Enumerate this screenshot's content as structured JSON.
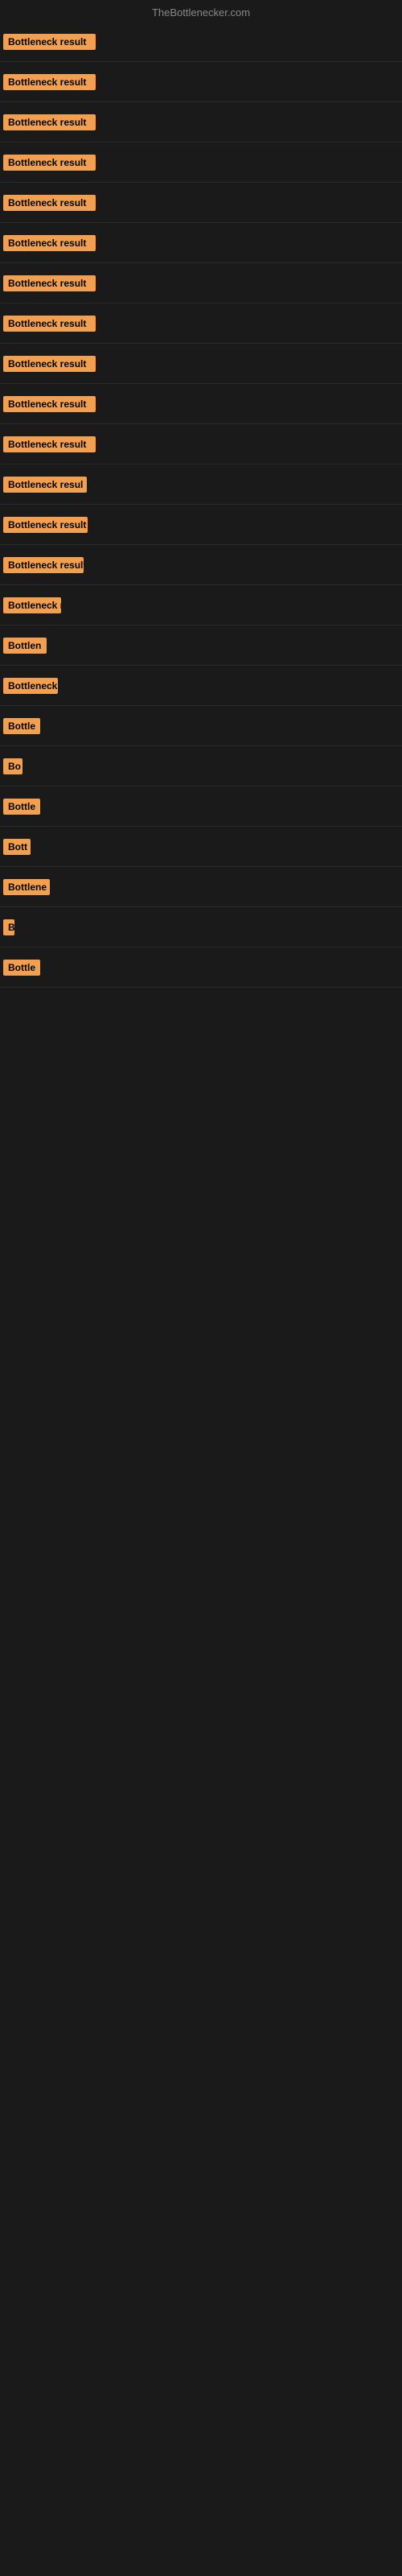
{
  "header": {
    "site_name": "TheBottlenecker.com"
  },
  "rows": [
    {
      "label": "Bottleneck result",
      "width": 115
    },
    {
      "label": "Bottleneck result",
      "width": 115
    },
    {
      "label": "Bottleneck result",
      "width": 115
    },
    {
      "label": "Bottleneck result",
      "width": 115
    },
    {
      "label": "Bottleneck result",
      "width": 115
    },
    {
      "label": "Bottleneck result",
      "width": 115
    },
    {
      "label": "Bottleneck result",
      "width": 115
    },
    {
      "label": "Bottleneck result",
      "width": 115
    },
    {
      "label": "Bottleneck result",
      "width": 115
    },
    {
      "label": "Bottleneck result",
      "width": 115
    },
    {
      "label": "Bottleneck result",
      "width": 115
    },
    {
      "label": "Bottleneck resul",
      "width": 104
    },
    {
      "label": "Bottleneck result",
      "width": 105
    },
    {
      "label": "Bottleneck result",
      "width": 100
    },
    {
      "label": "Bottleneck r",
      "width": 72
    },
    {
      "label": "Bottlen",
      "width": 54
    },
    {
      "label": "Bottleneck",
      "width": 68
    },
    {
      "label": "Bottle",
      "width": 46
    },
    {
      "label": "Bo",
      "width": 24
    },
    {
      "label": "Bottle",
      "width": 46
    },
    {
      "label": "Bott",
      "width": 34
    },
    {
      "label": "Bottlene",
      "width": 58
    },
    {
      "label": "B",
      "width": 14
    },
    {
      "label": "Bottle",
      "width": 46
    }
  ],
  "colors": {
    "badge_bg": "#f0a050",
    "body_bg": "#1a1a1a",
    "header_text": "#888888"
  }
}
